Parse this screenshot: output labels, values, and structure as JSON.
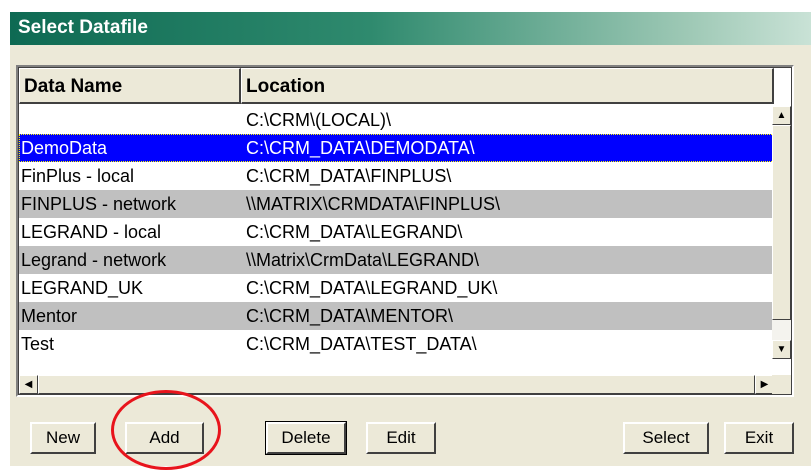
{
  "dialog": {
    "title": "Select Datafile"
  },
  "list": {
    "columns": [
      "Data Name",
      "Location"
    ],
    "rows": [
      {
        "name": "",
        "location": "C:\\CRM\\(LOCAL)\\",
        "style": "white"
      },
      {
        "name": "DemoData",
        "location": "C:\\CRM_DATA\\DEMODATA\\",
        "style": "selected"
      },
      {
        "name": "FinPlus - local",
        "location": "C:\\CRM_DATA\\FINPLUS\\",
        "style": "white"
      },
      {
        "name": "FINPLUS - network",
        "location": "\\\\MATRIX\\CRMDATA\\FINPLUS\\",
        "style": "gray"
      },
      {
        "name": "LEGRAND - local",
        "location": "C:\\CRM_DATA\\LEGRAND\\",
        "style": "white"
      },
      {
        "name": "Legrand - network",
        "location": "\\\\Matrix\\CrmData\\LEGRAND\\",
        "style": "gray"
      },
      {
        "name": "LEGRAND_UK",
        "location": "C:\\CRM_DATA\\LEGRAND_UK\\",
        "style": "white"
      },
      {
        "name": "Mentor",
        "location": "C:\\CRM_DATA\\MENTOR\\",
        "style": "gray"
      },
      {
        "name": "Test",
        "location": "C:\\CRM_DATA\\TEST_DATA\\",
        "style": "white"
      }
    ],
    "scroll_up_glyph": "▲",
    "scroll_down_glyph": "▼",
    "scroll_left_glyph": "◀",
    "scroll_right_glyph": "▶"
  },
  "buttons": {
    "new": "New",
    "add": "Add",
    "delete": "Delete",
    "edit": "Edit",
    "select": "Select",
    "exit": "Exit"
  },
  "colors": {
    "selection": "#0000ff",
    "annotation_circle": "#e8141c",
    "title_bar": "#0e6a53"
  }
}
